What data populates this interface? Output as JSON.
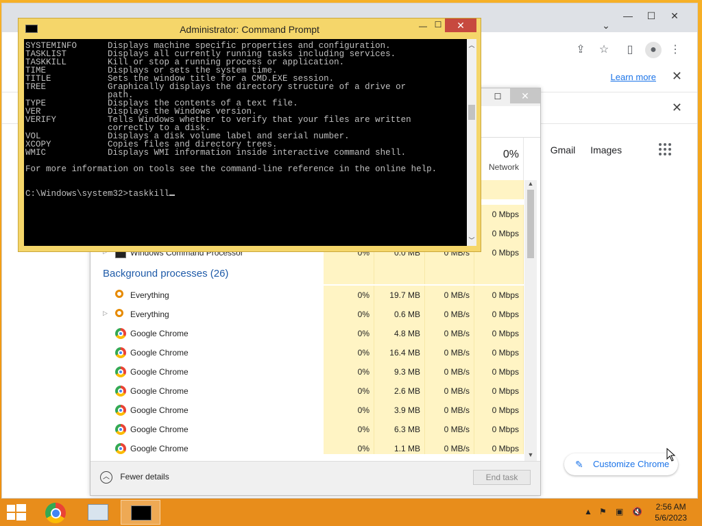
{
  "chrome": {
    "learn_more": "Learn more",
    "gmail": "Gmail",
    "images": "Images",
    "customize": "Customize Chrome",
    "win_min": "—",
    "win_max": "☐",
    "win_close": "✕",
    "chevron": "⌄",
    "close_x": "✕"
  },
  "taskmgr": {
    "network_pct": "0%",
    "network_label": "Network",
    "partial_row": {
      "name": "Windows Command Processor",
      "cpu": "0%",
      "mem": "0.0 MB",
      "disk": "0 MB/s",
      "net": "0 Mbps"
    },
    "top_rows": [
      {
        "net": "0 Mbps"
      },
      {
        "net": "0 Mbps"
      }
    ],
    "group_title": "Background processes (26)",
    "rows": [
      {
        "name": "Everything",
        "icon": "everything",
        "expand": "",
        "cpu": "0%",
        "mem": "19.7 MB",
        "disk": "0 MB/s",
        "net": "0 Mbps"
      },
      {
        "name": "Everything",
        "icon": "everything",
        "expand": "▷",
        "cpu": "0%",
        "mem": "0.6 MB",
        "disk": "0 MB/s",
        "net": "0 Mbps"
      },
      {
        "name": "Google Chrome",
        "icon": "chrome",
        "expand": "",
        "cpu": "0%",
        "mem": "4.8 MB",
        "disk": "0 MB/s",
        "net": "0 Mbps"
      },
      {
        "name": "Google Chrome",
        "icon": "chrome",
        "expand": "",
        "cpu": "0%",
        "mem": "16.4 MB",
        "disk": "0 MB/s",
        "net": "0 Mbps"
      },
      {
        "name": "Google Chrome",
        "icon": "chrome",
        "expand": "",
        "cpu": "0%",
        "mem": "9.3 MB",
        "disk": "0 MB/s",
        "net": "0 Mbps"
      },
      {
        "name": "Google Chrome",
        "icon": "chrome",
        "expand": "",
        "cpu": "0%",
        "mem": "2.6 MB",
        "disk": "0 MB/s",
        "net": "0 Mbps"
      },
      {
        "name": "Google Chrome",
        "icon": "chrome",
        "expand": "",
        "cpu": "0%",
        "mem": "3.9 MB",
        "disk": "0 MB/s",
        "net": "0 Mbps"
      },
      {
        "name": "Google Chrome",
        "icon": "chrome",
        "expand": "",
        "cpu": "0%",
        "mem": "6.3 MB",
        "disk": "0 MB/s",
        "net": "0 Mbps"
      },
      {
        "name": "Google Chrome",
        "icon": "chrome",
        "expand": "",
        "cpu": "0%",
        "mem": "1.1 MB",
        "disk": "0 MB/s",
        "net": "0 Mbps"
      }
    ],
    "fewer_details": "Fewer details",
    "end_task": "End task",
    "max": "☐",
    "close": "✕"
  },
  "cmd": {
    "title": "Administrator:  Command Prompt",
    "min": "—",
    "max": "☐",
    "close": "✕",
    "lines": [
      "SYSTEMINFO      Displays machine specific properties and configuration.",
      "TASKLIST        Displays all currently running tasks including services.",
      "TASKKILL        Kill or stop a running process or application.",
      "TIME            Displays or sets the system time.",
      "TITLE           Sets the window title for a CMD.EXE session.",
      "TREE            Graphically displays the directory structure of a drive or",
      "                path.",
      "TYPE            Displays the contents of a text file.",
      "VER             Displays the Windows version.",
      "VERIFY          Tells Windows whether to verify that your files are written",
      "                correctly to a disk.",
      "VOL             Displays a disk volume label and serial number.",
      "XCOPY           Copies files and directory trees.",
      "WMIC            Displays WMI information inside interactive command shell.",
      "",
      "For more information on tools see the command-line reference in the online help.",
      "",
      "",
      "C:\\Windows\\system32>taskkill"
    ]
  },
  "taskbar": {
    "time": "2:56 AM",
    "date": "5/6/2023"
  }
}
